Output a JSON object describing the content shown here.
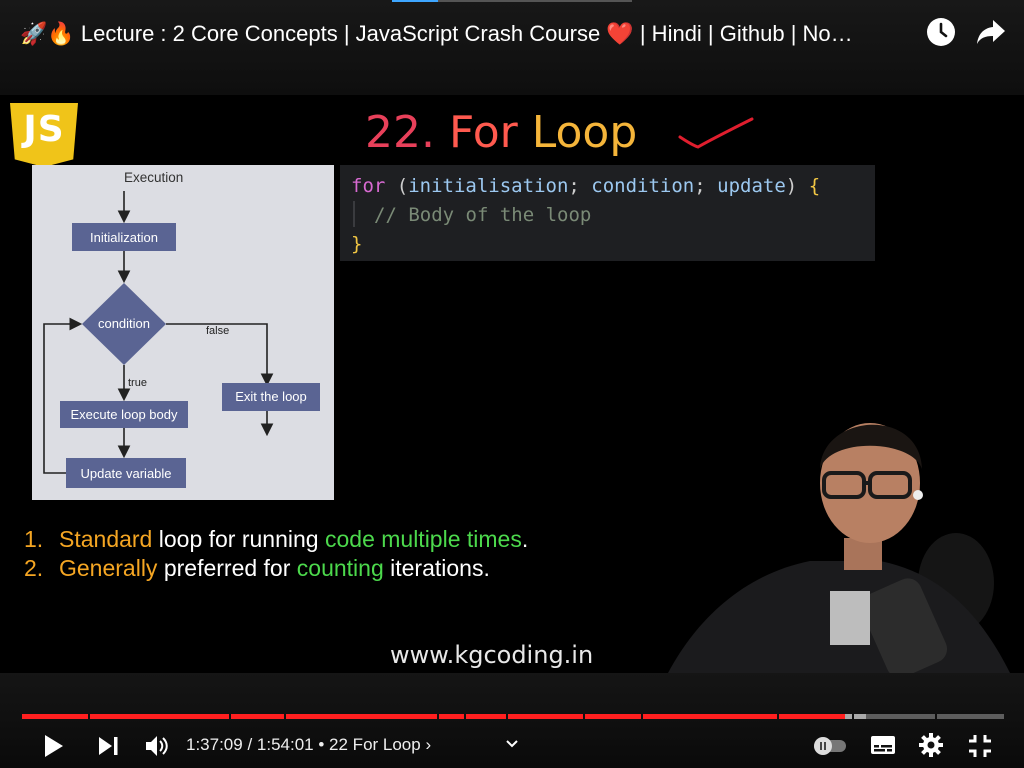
{
  "header": {
    "title_emoji_lead": "🚀🔥",
    "title_main": "Lecture : 2 Core Concepts | JavaScript Crash Course",
    "title_emoji_heart": "❤️",
    "title_tail": "| Hindi | Github | No…",
    "icons": [
      "clock-icon",
      "share-icon"
    ]
  },
  "slide": {
    "logo_text": "JS",
    "heading_number": "22.",
    "heading_for": "For",
    "heading_loop": "Loop",
    "flowchart": {
      "start": "Execution",
      "init": "Initialization",
      "condition": "condition",
      "false_label": "false",
      "true_label": "true",
      "body": "Execute loop body",
      "exit": "Exit the loop",
      "update": "Update variable"
    },
    "code": {
      "kw_for": "for",
      "open_paren": "(",
      "p1": "initialisation",
      "semi1": ";",
      "p2": "condition",
      "semi2": ";",
      "p3": "update",
      "close_paren": ")",
      "open_brace": "{",
      "comment": "// Body of the loop",
      "close_brace": "}"
    },
    "bullets": [
      {
        "num": "1.",
        "parts": [
          [
            "Standard",
            "orange"
          ],
          [
            " loop for running ",
            "white"
          ],
          [
            "code multiple times",
            "green"
          ],
          [
            ".",
            "white"
          ]
        ]
      },
      {
        "num": "2.",
        "parts": [
          [
            "Generally",
            "orange"
          ],
          [
            " preferred for ",
            "white"
          ],
          [
            "counting",
            "green"
          ],
          [
            " iterations.",
            "white"
          ]
        ]
      }
    ],
    "site_url": "www.kgcoding.in"
  },
  "player": {
    "progress": {
      "played_fraction": 0.8385,
      "buffered_fraction": 0.8593
    },
    "time_current": "1:37:09",
    "time_separator": " / ",
    "time_total": "1:54:01",
    "chapter_bullet": " • ",
    "chapter": "22 For Loop",
    "chapter_arrow": "›",
    "icons": [
      "play-icon",
      "next-icon",
      "volume-icon",
      "chevron-down-icon",
      "autoplay-toggle-icon",
      "captions-icon",
      "settings-icon",
      "exit-fullscreen-icon"
    ]
  },
  "colors": {
    "played": "#ff1f1f",
    "buffered": "#a9a9a9",
    "js_yellow": "#f0c419",
    "flow_box": "#5a6493"
  }
}
